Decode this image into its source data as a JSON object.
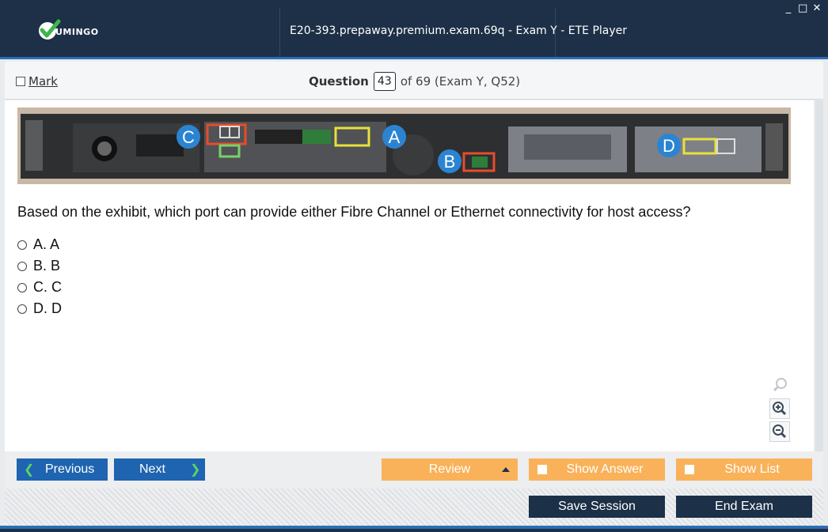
{
  "app": {
    "logo_text": "UMINGO",
    "window_title": "E20-393.prepaway.premium.exam.69q - Exam Y - ETE Player",
    "controls": {
      "minimize": "_",
      "maximize": "□",
      "close": "✕"
    }
  },
  "header": {
    "mark_label": "Mark",
    "question_label": "Question",
    "question_number": "43",
    "question_of": "of 69 (Exam Y, Q52)"
  },
  "exhibit": {
    "callouts": [
      "C",
      "A",
      "B",
      "D"
    ]
  },
  "question": {
    "text": "Based on the exhibit, which port can provide either Fibre Channel or Ethernet connectivity for host access?",
    "options": [
      "A. A",
      "B. B",
      "C. C",
      "D. D"
    ]
  },
  "nav": {
    "previous": "Previous",
    "next": "Next",
    "review": "Review",
    "show_answer": "Show Answer",
    "show_list": "Show List"
  },
  "footer": {
    "save_session": "Save Session",
    "end_exam": "End Exam"
  },
  "colors": {
    "title_bar": "#1d3047",
    "primary_blue": "#1e64b0",
    "orange": "#f9b25a",
    "dark_button": "#1c3047",
    "logo_green": "#3db54a"
  }
}
